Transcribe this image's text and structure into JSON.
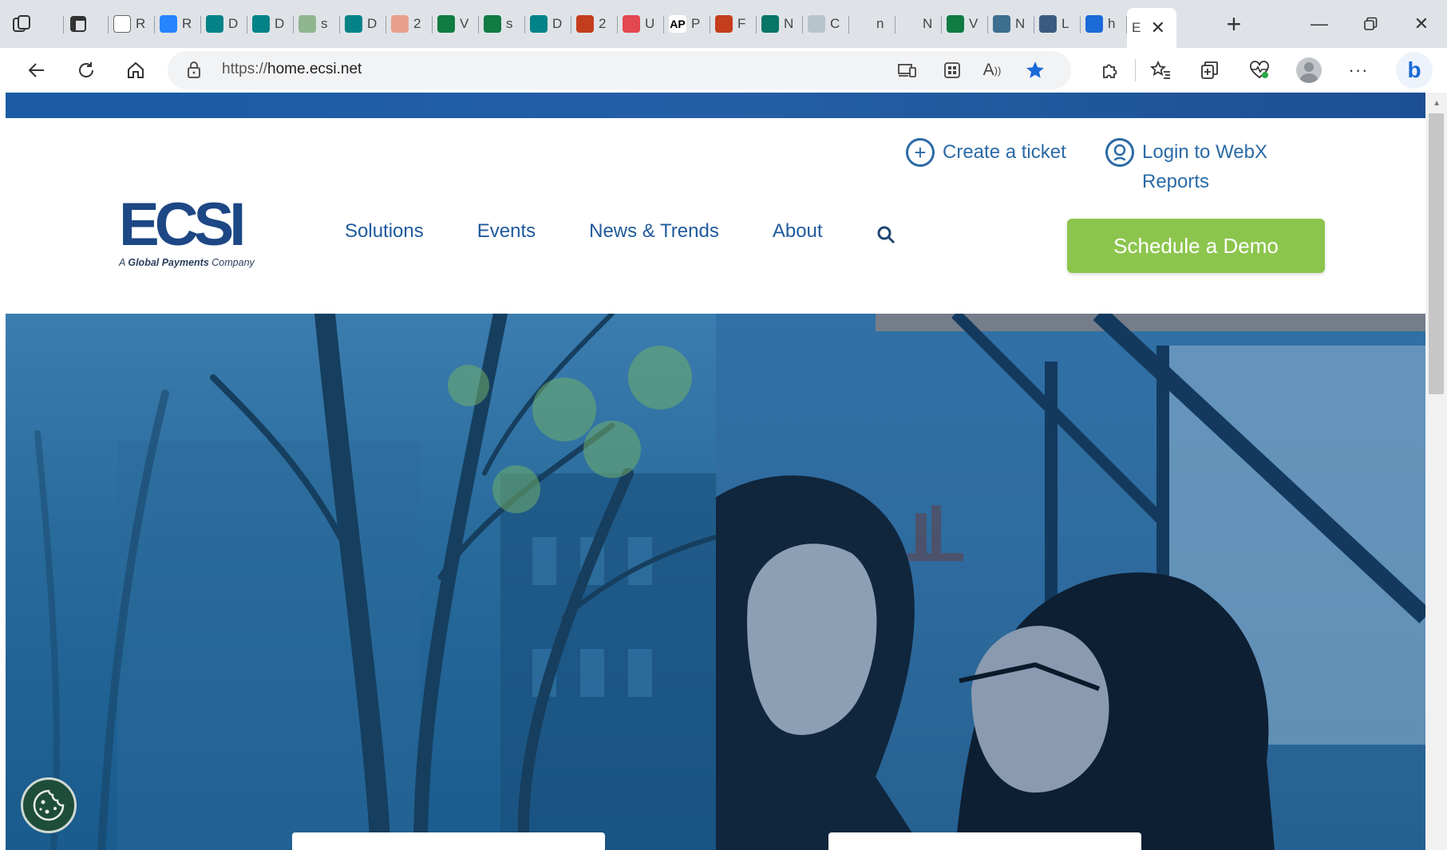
{
  "browser": {
    "tabs": [
      {
        "letter": "",
        "icon": "workspaces-icon",
        "color": "#dfe3e8"
      },
      {
        "letter": "",
        "icon": "tab-actions-icon",
        "color": "#dfe3e8"
      },
      {
        "letter": "R",
        "icon": "document-icon",
        "color": "#ffffff"
      },
      {
        "letter": "R",
        "icon": "jira-icon",
        "color": "#2684ff"
      },
      {
        "letter": "D",
        "icon": "sharepoint-icon",
        "color": "#038387"
      },
      {
        "letter": "D",
        "icon": "sharepoint-icon",
        "color": "#038387"
      },
      {
        "letter": "s",
        "icon": "excel-icon",
        "color": "#8fb58f"
      },
      {
        "letter": "D",
        "icon": "sharepoint-icon",
        "color": "#038387"
      },
      {
        "letter": "2",
        "icon": "powerpoint-icon",
        "color": "#e8a08a"
      },
      {
        "letter": "V",
        "icon": "excel-icon",
        "color": "#107c41"
      },
      {
        "letter": "s",
        "icon": "excel-icon",
        "color": "#107c41"
      },
      {
        "letter": "D",
        "icon": "sharepoint-icon",
        "color": "#038387"
      },
      {
        "letter": "2",
        "icon": "powerpoint-icon",
        "color": "#c43e1c"
      },
      {
        "letter": "U",
        "icon": "oracle-icon",
        "color": "#e3474f"
      },
      {
        "letter": "P",
        "icon": "ap-news-icon",
        "color": "#000000",
        "text": "AP"
      },
      {
        "letter": "F",
        "icon": "powerpoint-icon",
        "color": "#c43e1c"
      },
      {
        "letter": "N",
        "icon": "forms-icon",
        "color": "#077568"
      },
      {
        "letter": "C",
        "icon": "shield-icon",
        "color": "#b8c4cc"
      },
      {
        "letter": "n",
        "icon": "blank-icon",
        "color": "#dfe3e8"
      },
      {
        "letter": "N",
        "icon": "blank-icon",
        "color": "#dfe3e8"
      },
      {
        "letter": "V",
        "icon": "excel-icon",
        "color": "#107c41"
      },
      {
        "letter": "N",
        "icon": "shield-icon",
        "color": "#3b6e8f"
      },
      {
        "letter": "L",
        "icon": "plane-icon",
        "color": "#3c5a80"
      },
      {
        "letter": "h",
        "icon": "search-icon",
        "color": "#1b6ad7"
      }
    ],
    "active_tab": {
      "letter": "E",
      "icon": "ecsi-icon"
    },
    "address": {
      "scheme": "https://",
      "host": "home.ecsi.net"
    },
    "colors": {
      "titlebar": "#dfe3e8",
      "favorite_star": "#1b6ad7",
      "bing": "#1b6ad7"
    }
  },
  "page": {
    "utility": {
      "create_ticket": "Create a ticket",
      "login_line1": "Login to WebX",
      "login_line2": "Reports"
    },
    "logo": {
      "mark": "ECSI",
      "sub_prefix": "A ",
      "sub_bold": "Global Payments",
      "sub_suffix": " Company"
    },
    "nav": {
      "items": [
        "Solutions",
        "Events",
        "News & Trends",
        "About"
      ]
    },
    "cta": {
      "label": "Schedule a Demo"
    },
    "colors": {
      "topbar": "#1a5ba4",
      "brand_blue": "#1d4785",
      "link_blue": "#2b6aa6",
      "cta_green": "#8cc54d",
      "cookie_button": "#1f4d3b"
    }
  }
}
